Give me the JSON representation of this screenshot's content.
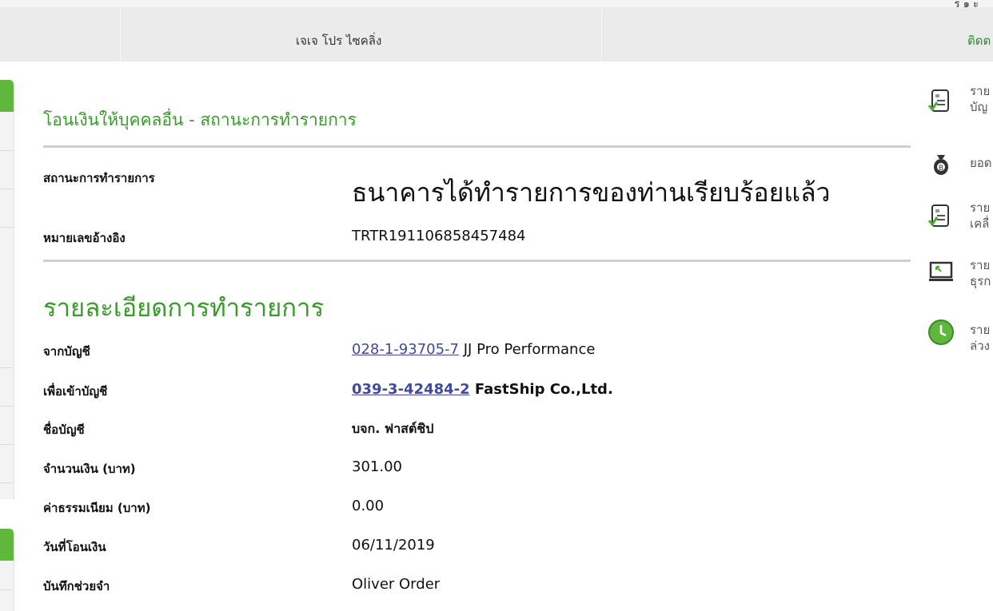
{
  "header": {
    "top_partial_text": "ร ๑ ะ",
    "user_name": "เจเจ โปร ไซคลิ่ง",
    "contact_label_partial": "ติดต"
  },
  "page": {
    "title": "โอนเงินให้บุคคลอื่น - สถานะการทำรายการ"
  },
  "status": {
    "label": "สถานะการทำรายการ",
    "value": "ธนาคารได้ทำรายการของท่านเรียบร้อยแล้ว",
    "ref_label": "หมายเลขอ้างอิง",
    "ref_value": "TRTR191106858457484"
  },
  "details": {
    "heading": "รายละเอียดการทำรายการ",
    "from_label": "จากบัญชี",
    "from_account": "028-1-93705-7",
    "from_name": " JJ Pro Performance",
    "to_label": "เพื่อเข้าบัญชี",
    "to_account": "039-3-42484-2",
    "to_name": " FastShip Co.,Ltd.",
    "account_name_label": "ชื่อบัญชี",
    "account_name_value": "บจก. ฟาสต์ชิป",
    "amount_label": "จำนวนเงิน (บาท)",
    "amount_value": "301.00",
    "fee_label": "ค่าธรรมเนียม (บาท)",
    "fee_value": "0.00",
    "date_label": "วันที่โอนเงิน",
    "date_value": "06/11/2019",
    "memo_label": "บันทึกช่วยจำ",
    "memo_value": "Oliver Order"
  },
  "right_menu": {
    "items": [
      {
        "icon": "statement-check-icon",
        "line1": "ราย",
        "line2": "บัญ"
      },
      {
        "icon": "money-bag-icon",
        "line1": "ยอด",
        "line2": ""
      },
      {
        "icon": "statement-check-icon",
        "line1": "ราย",
        "line2": "เคลื่"
      },
      {
        "icon": "monitor-cursor-icon",
        "line1": "ราย",
        "line2": "ธุรก"
      },
      {
        "icon": "clock-icon",
        "line1": "ราย",
        "line2": "ล่วง"
      }
    ]
  },
  "colors": {
    "brand_green": "#3a9a2c",
    "link_blue": "#404a98",
    "nav_bg": "#ebebeb"
  }
}
